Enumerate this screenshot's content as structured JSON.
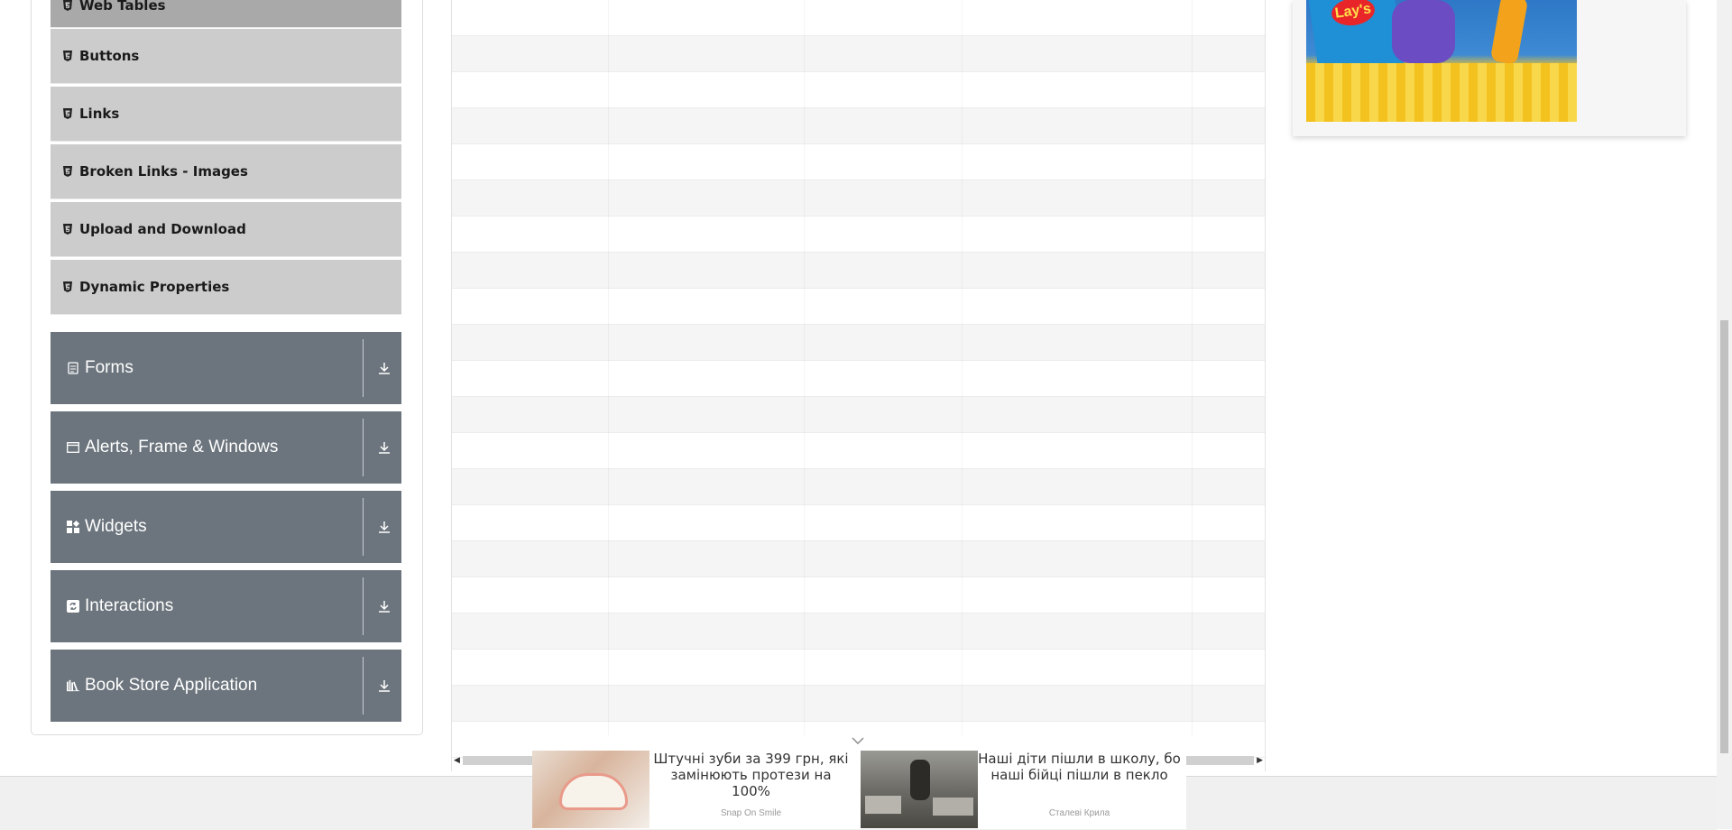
{
  "sidebar": {
    "elements_items": [
      {
        "label": "Web Tables"
      },
      {
        "label": "Buttons"
      },
      {
        "label": "Links"
      },
      {
        "label": "Broken Links - Images"
      },
      {
        "label": "Upload and Download"
      },
      {
        "label": "Dynamic Properties"
      }
    ],
    "groups": [
      {
        "label": "Forms",
        "icon": "document-icon"
      },
      {
        "label": "Alerts, Frame & Windows",
        "icon": "window-icon"
      },
      {
        "label": "Widgets",
        "icon": "widgets-icon"
      },
      {
        "label": "Interactions",
        "icon": "interactions-icon"
      },
      {
        "label": "Book Store Application",
        "icon": "bookshelf-icon"
      }
    ]
  },
  "bottom_ad": {
    "cards": [
      {
        "headline": "Штучні зуби за 399 грн, які замінюють протези на 100%",
        "source": "Snap On Smile"
      },
      {
        "headline": "Наші діти пішли в школу, бо наші бійці пішли в пекло",
        "source": "Сталеві Крила"
      }
    ]
  },
  "side_ad": {
    "brand": "Lay's"
  },
  "colors": {
    "group_bg": "#6c757d",
    "subitem_bg": "#cccccc",
    "row_alt": "#f5f5f5"
  }
}
